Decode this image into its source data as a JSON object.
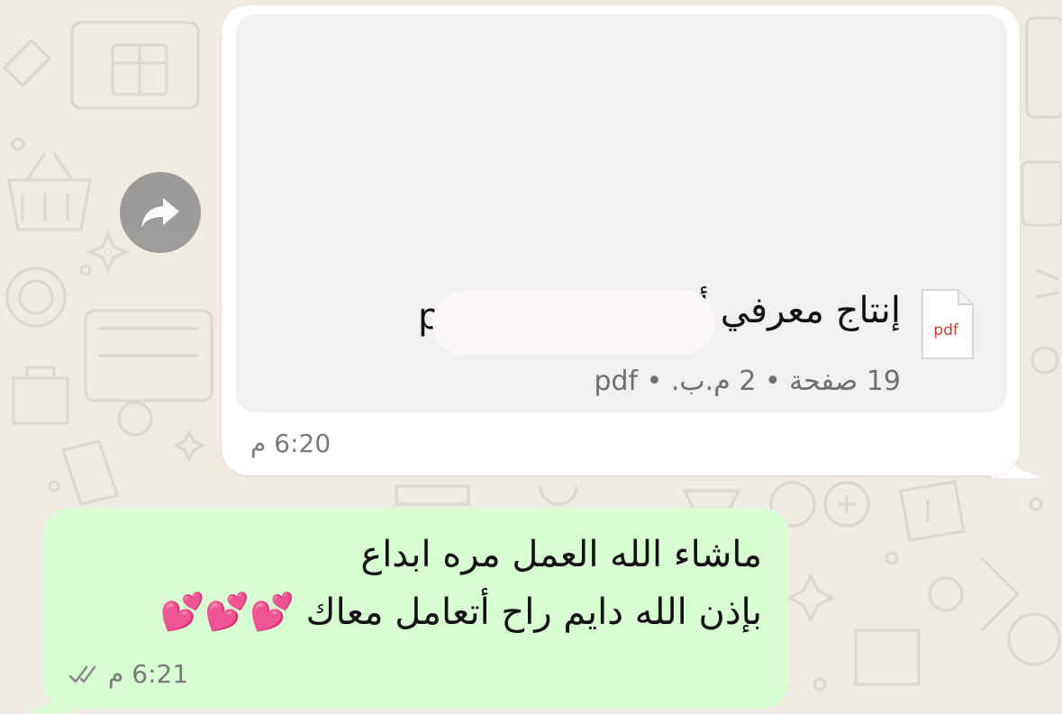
{
  "incoming_message": {
    "document": {
      "type_label": "pdf",
      "title_visible": "إنتاج معرفي أ",
      "title_fragment_after_redaction": "p",
      "meta": "19 صفحة • 2 م.ب. • pdf"
    },
    "time": "6:20 م"
  },
  "outgoing_message": {
    "line1": "ماشاء الله العمل مره ابداع",
    "line2": "بإذن الله دايم راح أتعامل معاك",
    "emoji": "💕💕💕",
    "time": "6:21 م",
    "status": "read"
  },
  "icons": {
    "forward": "forward-arrow-icon",
    "file": "pdf-file-icon",
    "ticks": "double-check-icon"
  },
  "colors": {
    "wallpaper": "#efeae2",
    "incoming_bubble": "#ffffff",
    "outgoing_bubble": "#d9fdd3",
    "pdf_label": "#d23a2f"
  }
}
